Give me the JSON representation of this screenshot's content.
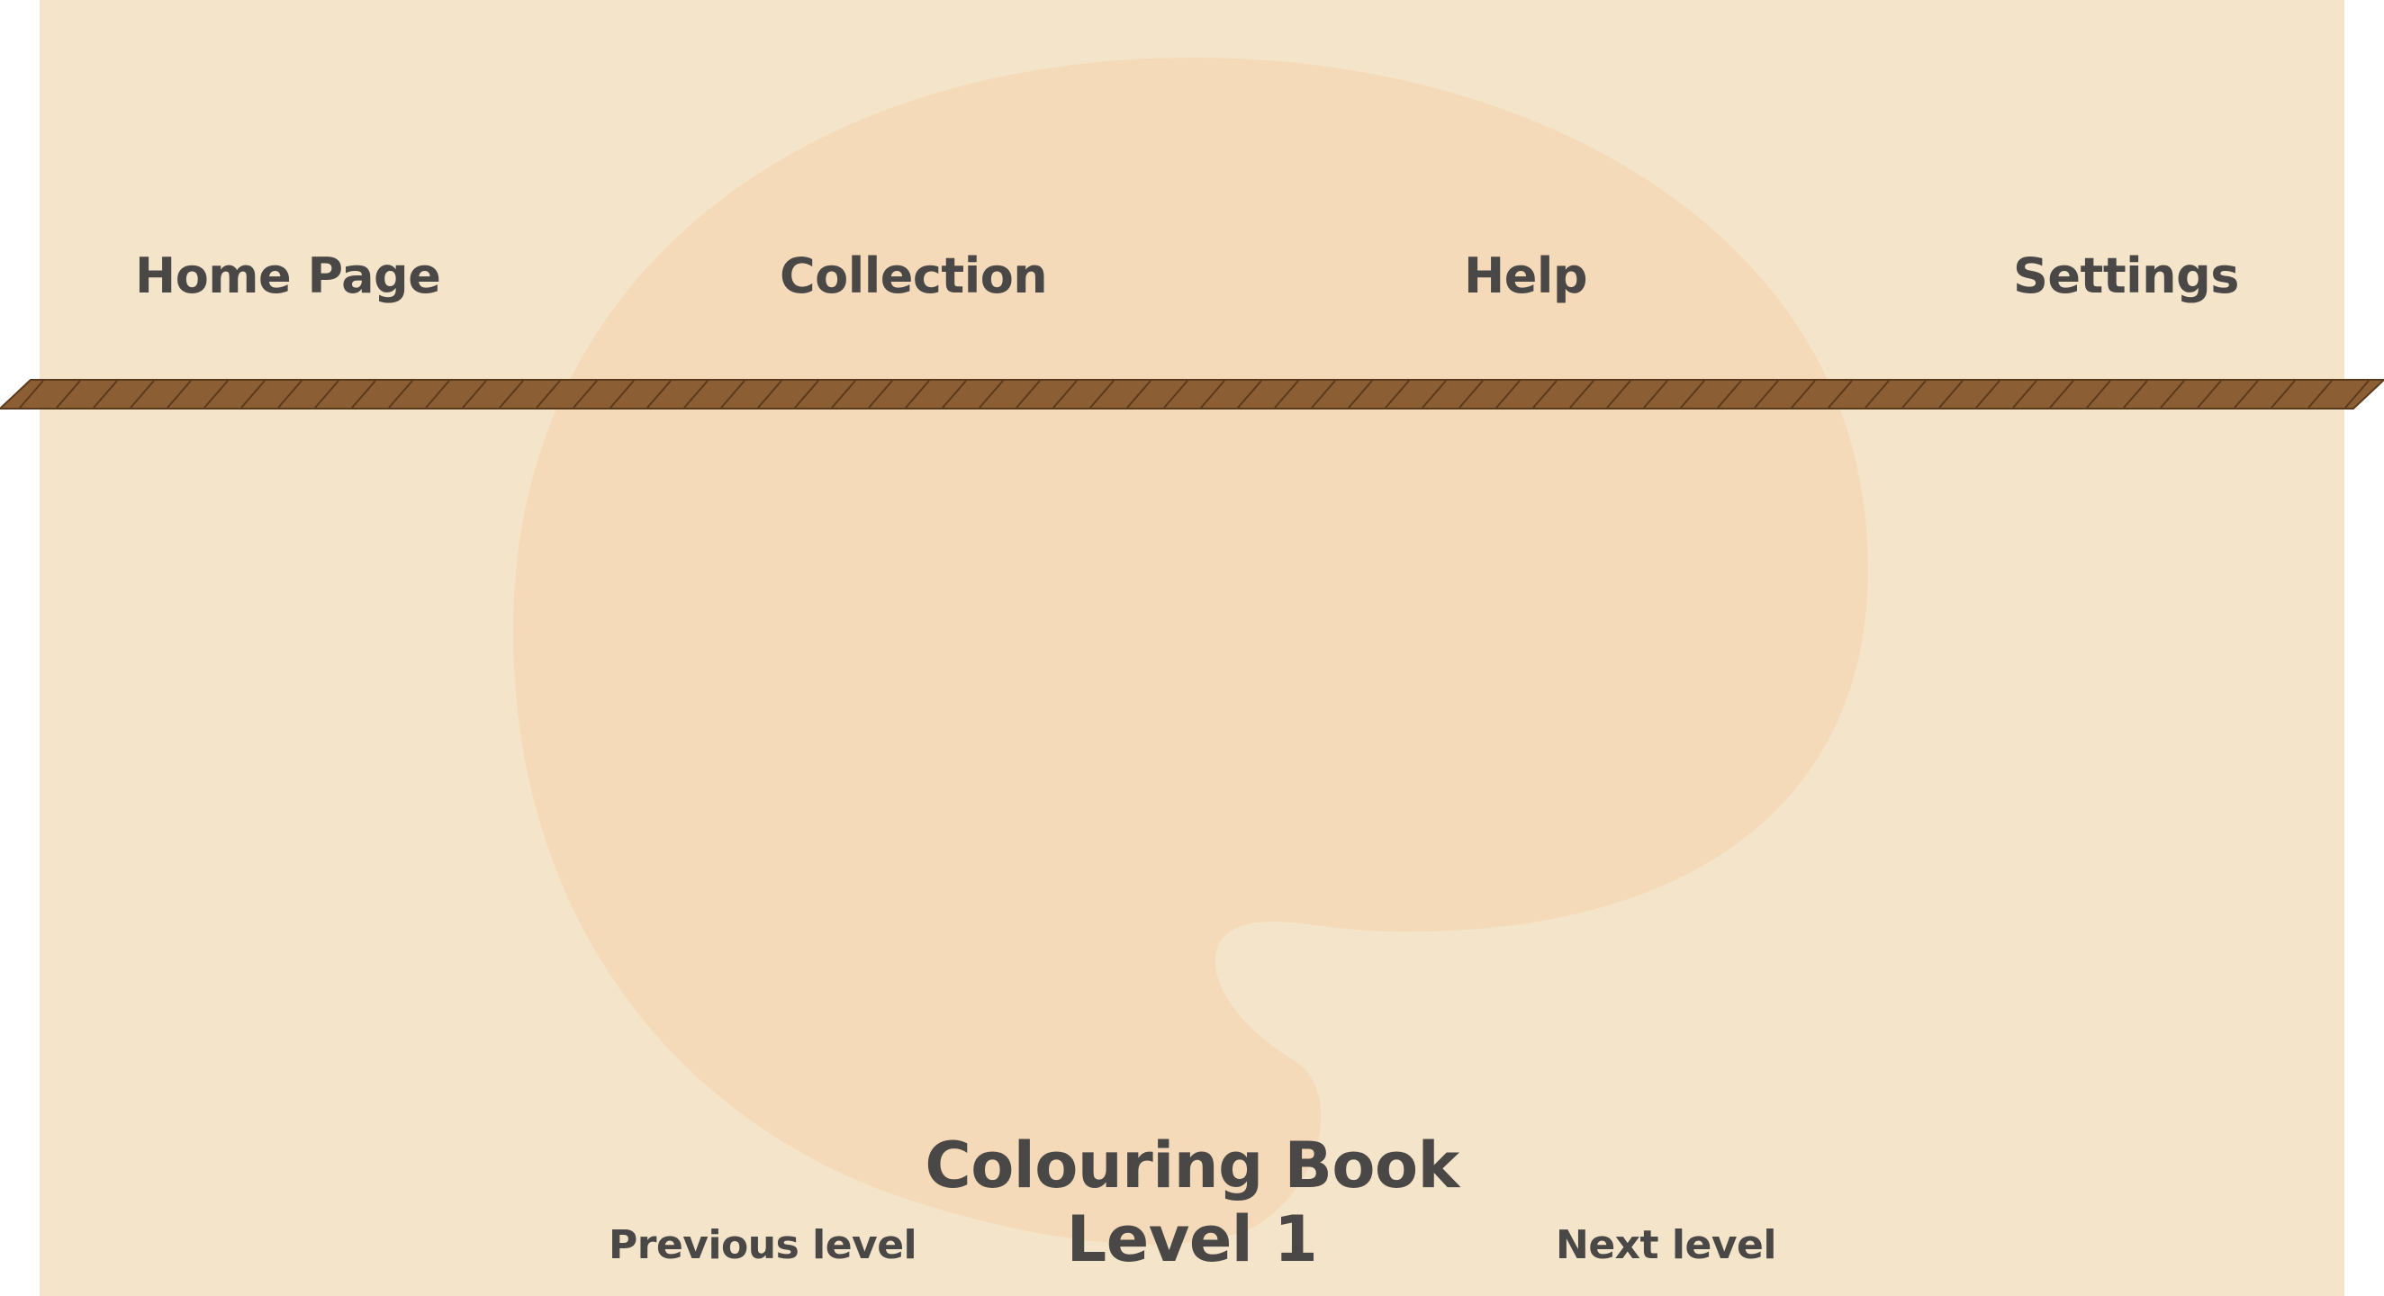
{
  "nav": {
    "home": "Home Page",
    "collection": "Collection",
    "help": "Help",
    "settings": "Settings"
  },
  "book": {
    "title": "Colouring Book",
    "level": "Level 1"
  },
  "level_nav": {
    "previous": "Previous level",
    "next": "Next level"
  },
  "colors": {
    "background": "#f4e4c9",
    "palette_blob": "#f4dab8",
    "rope": "#8b5e34",
    "text": "#4a4747"
  },
  "icons": {
    "palette": "palette-shape-icon",
    "divider": "rope-divider"
  }
}
